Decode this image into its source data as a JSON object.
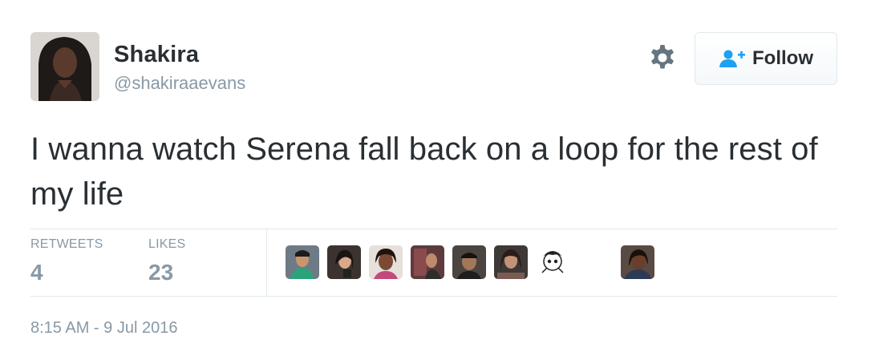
{
  "user": {
    "name": "Shakira",
    "handle": "@shakiraaevans"
  },
  "follow_button": {
    "label": "Follow",
    "icon": "add-user-icon",
    "accent": "#1da1f2"
  },
  "settings": {
    "icon": "gear-icon"
  },
  "tweet": {
    "text": "I wanna watch Serena fall back on a loop for the rest of my life"
  },
  "stats": {
    "retweets_label": "RETWEETS",
    "retweets_count": "4",
    "likes_label": "LIKES",
    "likes_count": "23"
  },
  "likers": [
    {
      "icon": "liker-avatar-1"
    },
    {
      "icon": "liker-avatar-2"
    },
    {
      "icon": "liker-avatar-3"
    },
    {
      "icon": "liker-avatar-4"
    },
    {
      "icon": "liker-avatar-5"
    },
    {
      "icon": "liker-avatar-6"
    },
    {
      "icon": "liker-avatar-7"
    },
    {
      "icon": "liker-avatar-8"
    }
  ],
  "timestamp": "8:15 AM - 9 Jul 2016",
  "colors": {
    "text": "#292f33",
    "muted": "#8899a6",
    "divider": "#e1e8ed"
  }
}
